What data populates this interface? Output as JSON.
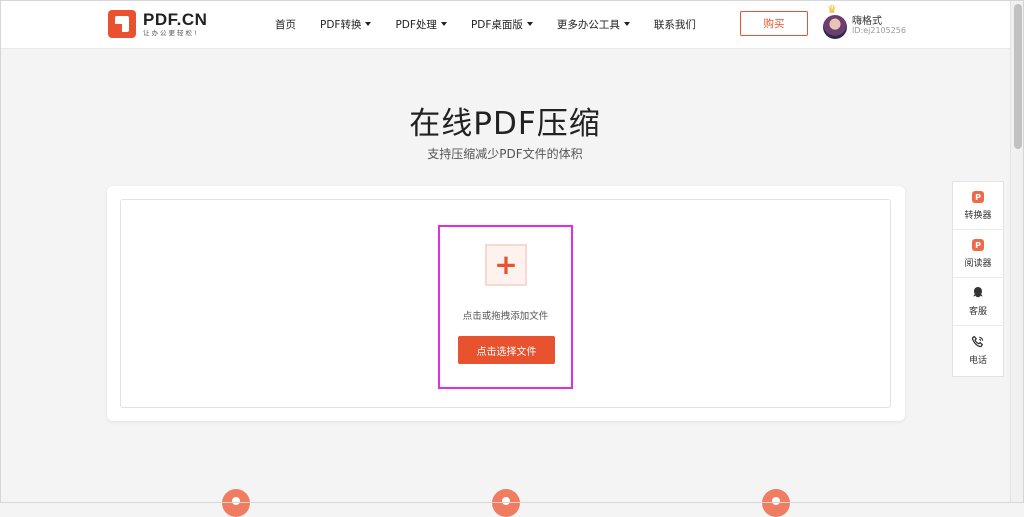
{
  "brand": {
    "name": "PDF.CN",
    "slogan": "让办公更轻松!"
  },
  "nav": [
    {
      "label": "首页",
      "dropdown": false
    },
    {
      "label": "PDF转换",
      "dropdown": true
    },
    {
      "label": "PDF处理",
      "dropdown": true
    },
    {
      "label": "PDF桌面版",
      "dropdown": true
    },
    {
      "label": "更多办公工具",
      "dropdown": true
    },
    {
      "label": "联系我们",
      "dropdown": false
    }
  ],
  "header": {
    "buy_label": "购买"
  },
  "user": {
    "name": "嗨格式",
    "id": "ID:ej2105256"
  },
  "main": {
    "title": "在线PDF压缩",
    "subtitle": "支持压缩减少PDF文件的体积",
    "drop_hint": "点击或拖拽添加文件",
    "select_button": "点击选择文件",
    "add_icon_glyph": "+"
  },
  "side_panel": [
    {
      "label": "转换器",
      "icon": "converter-icon"
    },
    {
      "label": "阅读器",
      "icon": "reader-icon"
    },
    {
      "label": "客服",
      "icon": "customer-service-icon"
    },
    {
      "label": "电话",
      "icon": "phone-icon"
    }
  ],
  "colors": {
    "accent": "#e8522f",
    "highlight": "#e02fe0",
    "background": "#f4f4f4"
  }
}
